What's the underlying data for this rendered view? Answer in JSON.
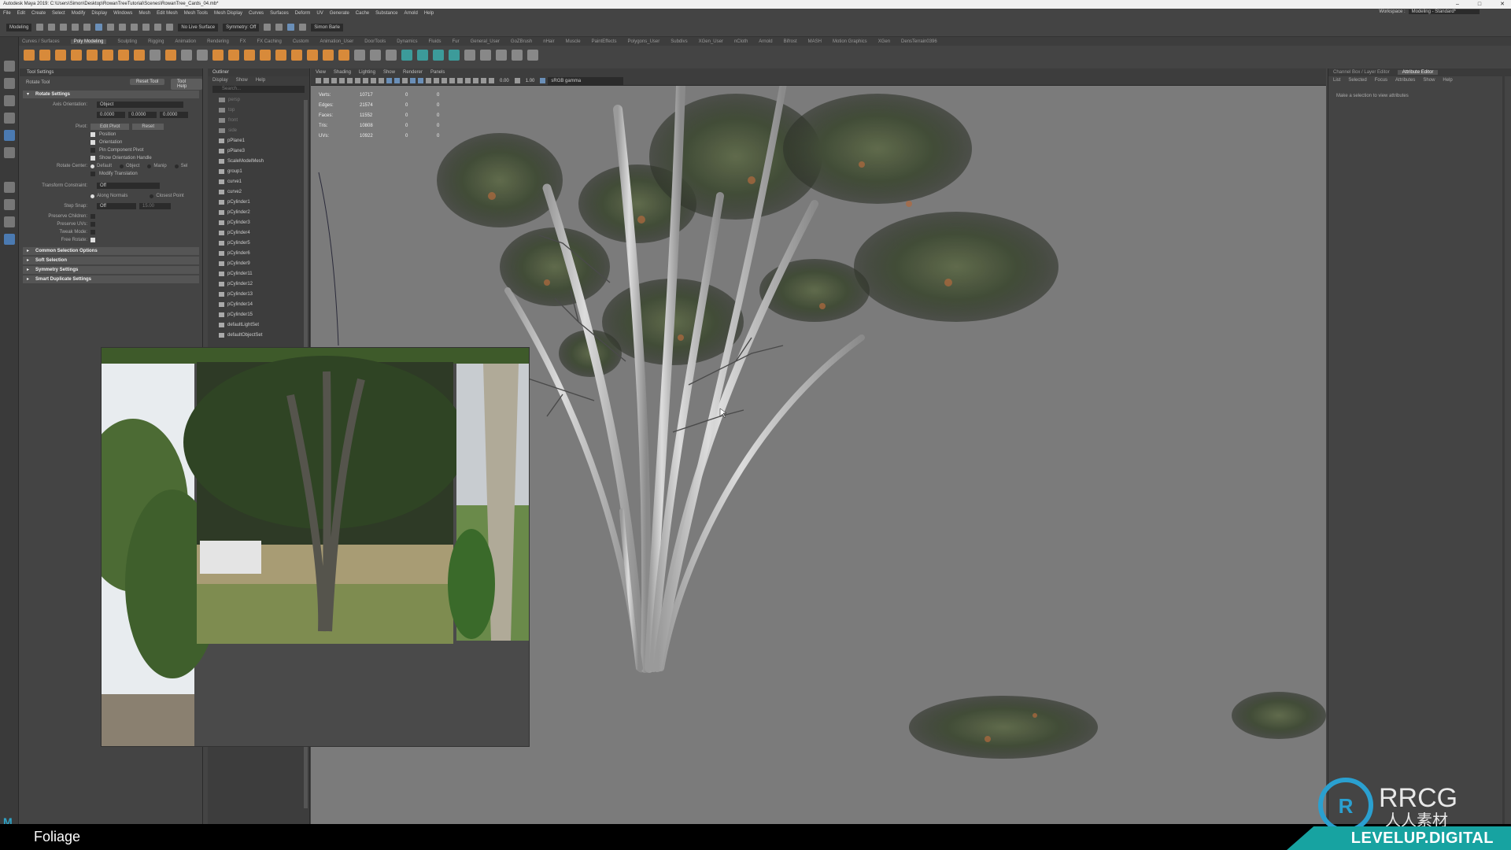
{
  "title": "Autodesk Maya 2019: C:\\Users\\Simon\\Desktop\\RowanTreeTutorial\\Scenes\\RowanTree_Cards_04.mb*",
  "menus": [
    "File",
    "Edit",
    "Create",
    "Select",
    "Modify",
    "Display",
    "Windows",
    "Mesh",
    "Edit Mesh",
    "Mesh Tools",
    "Mesh Display",
    "Curves",
    "Surfaces",
    "Deform",
    "UV",
    "Generate",
    "Cache",
    "Substance",
    "Arnold",
    "Help"
  ],
  "workspace": {
    "label": "Workspace :",
    "value": "Modeling - Standard*"
  },
  "status": {
    "mode": "Modeling",
    "live_surface": "No Live Surface",
    "symmetry": "Symmetry: Off",
    "signin": "Simon Barle"
  },
  "shelf_tabs": [
    "Curves / Surfaces",
    "Poly Modeling",
    "Sculpting",
    "Rigging",
    "Animation",
    "Rendering",
    "FX",
    "FX Caching",
    "Custom",
    "Animation_User",
    "DoorTools",
    "Dynamics",
    "Fluids",
    "Fur",
    "General_User",
    "GoZBrush",
    "nHair",
    "Muscle",
    "PaintEffects",
    "Polygons_User",
    "Subdivs",
    "XGen_User",
    "nCloth",
    "Arnold",
    "Bifrost",
    "MASH",
    "Motion Graphics",
    "XGen",
    "DensTerrain0396"
  ],
  "shelf_active": "Poly Modeling",
  "tool_settings": {
    "panel": "Tool Settings",
    "tool": "Rotate Tool",
    "reset": "Reset Tool",
    "help": "Tool Help",
    "section": "Rotate Settings",
    "axis_orientation_label": "Axis Orientation:",
    "axis_orientation": "Object",
    "xyz": [
      "0.0000",
      "0.0000",
      "0.0000"
    ],
    "pivot_label": "Pivot:",
    "edit_pivot": "Edit Pivot",
    "reset_pivot": "Reset",
    "checks": [
      "Position",
      "Orientation",
      "Pin Component Pivot",
      "Show Orientation Handle",
      "Modify Translation"
    ],
    "rotate_center_label": "Rotate Center:",
    "rotate_center": [
      "Default",
      "Object",
      "Manip",
      "Sel"
    ],
    "transform_constraint_label": "Transform Constraint:",
    "transform_constraint": "Off",
    "along_normals": "Along Normals",
    "closest_point": "Closest Point",
    "step_snap_label": "Step Snap:",
    "step_snap": "Off",
    "step_value": "15.00",
    "preserve_children": "Preserve Children:",
    "preserve_uvs": "Preserve UVs:",
    "tweak_mode": "Tweak Mode:",
    "free_rotate": "Free Rotate:",
    "collapsed": [
      "Common Selection Options",
      "Soft Selection",
      "Symmetry Settings",
      "Smart Duplicate Settings"
    ]
  },
  "outliner": {
    "title": "Outliner",
    "menus": [
      "Display",
      "Show",
      "Help"
    ],
    "search": "Search...",
    "items": [
      "persp",
      "top",
      "front",
      "side",
      "pPlane1",
      "pPlane3",
      "ScaleModelMesh",
      "group1",
      "curve1",
      "curve2",
      "pCylinder1",
      "pCylinder2",
      "pCylinder3",
      "pCylinder4",
      "pCylinder5",
      "pCylinder6",
      "pCylinder9",
      "pCylinder11",
      "pCylinder12",
      "pCylinder13",
      "pCylinder14",
      "pCylinder15",
      "defaultLightSet",
      "defaultObjectSet"
    ]
  },
  "viewport": {
    "menus": [
      "View",
      "Shading",
      "Lighting",
      "Show",
      "Renderer",
      "Panels"
    ],
    "exposure": "0.00",
    "gamma": "1.00",
    "colorspace": "sRGB gamma",
    "hud": [
      {
        "label": "Verts:",
        "value": "10717",
        "a": "0",
        "b": "0"
      },
      {
        "label": "Edges:",
        "value": "21574",
        "a": "0",
        "b": "0"
      },
      {
        "label": "Faces:",
        "value": "11552",
        "a": "0",
        "b": "0"
      },
      {
        "label": "Tris:",
        "value": "10808",
        "a": "0",
        "b": "0"
      },
      {
        "label": "UVs:",
        "value": "10922",
        "a": "0",
        "b": "0"
      }
    ]
  },
  "attribute_editor": {
    "tabs": [
      "Channel Box / Layer Editor",
      "Attribute Editor"
    ],
    "menus": [
      "List",
      "Selected",
      "Focus",
      "Attributes",
      "Show",
      "Help"
    ],
    "message": "Make a selection to view attributes"
  },
  "caption": "Foliage",
  "watermark": {
    "brand": "RRCG",
    "sub": "人人素材",
    "site": "LEVELUP.DIGITAL"
  },
  "colors": {
    "accent": "#4b7ab1",
    "viewport": "#7b7b7b",
    "teal": "#17a3a1"
  }
}
